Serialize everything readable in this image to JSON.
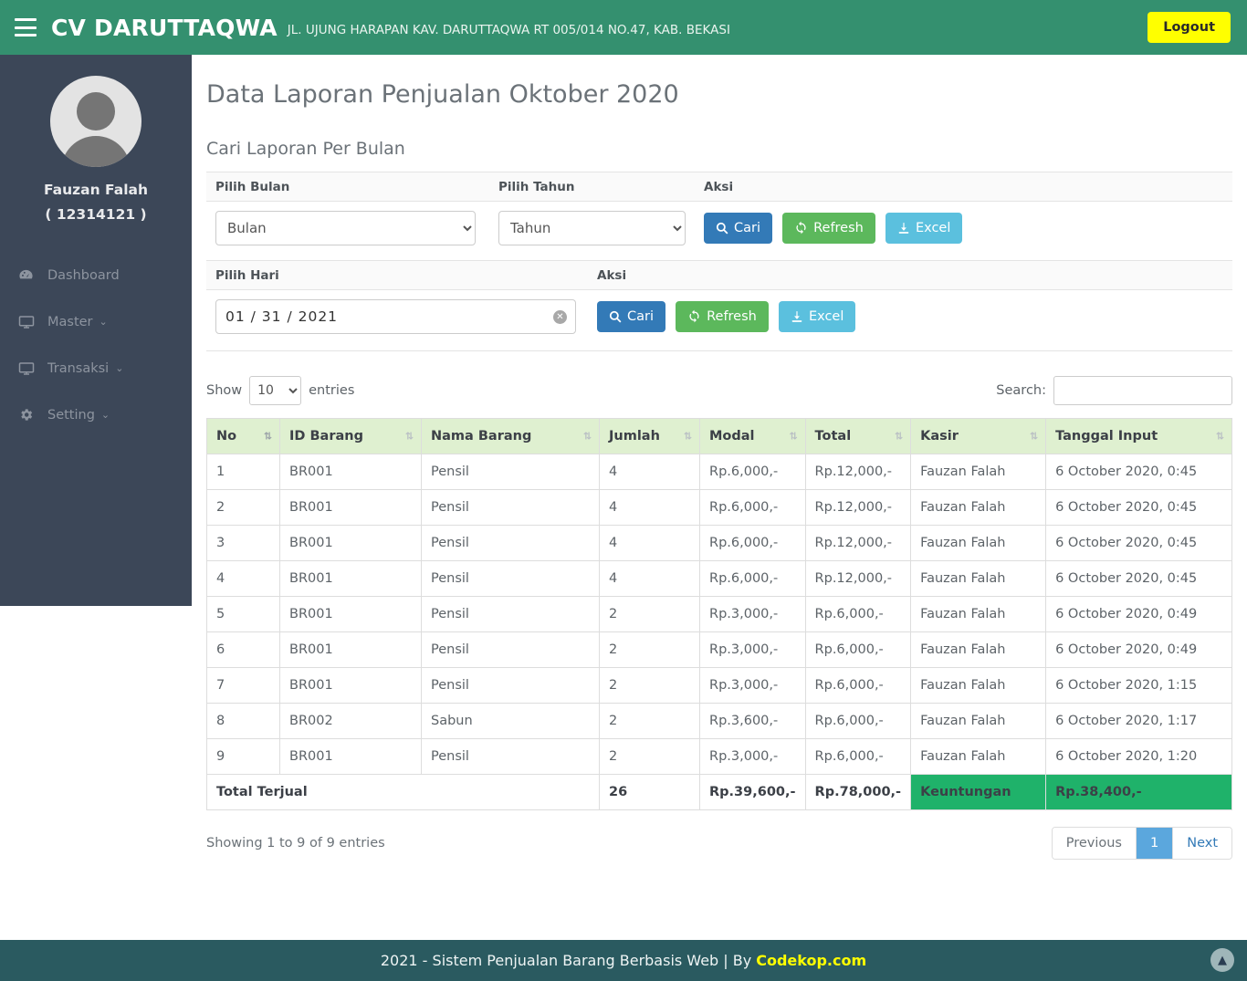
{
  "navbar": {
    "menu_icon": "hamburger-icon",
    "brand": "CV DARUTTAQWA",
    "address": "JL. UJUNG HARAPAN KAV. DARUTTAQWA RT 005/014 NO.47, KAB. BEKASI",
    "logout_label": "Logout",
    "bg_color": "#34906f",
    "logout_color": "#ffff00"
  },
  "sidebar": {
    "user_name": "Fauzan Falah",
    "user_id": "( 12314121 )",
    "bg_color": "#3c4758",
    "items": [
      {
        "label": "Dashboard",
        "icon": "dashboard-icon",
        "has_caret": false
      },
      {
        "label": "Master",
        "icon": "monitor-icon",
        "has_caret": true,
        "caret": "⌄"
      },
      {
        "label": "Transaksi",
        "icon": "monitor-icon",
        "has_caret": true,
        "caret": "⌄"
      },
      {
        "label": "Setting",
        "icon": "gear-icon",
        "has_caret": true,
        "caret": "⌄"
      }
    ]
  },
  "main": {
    "page_title": "Data Laporan Penjualan Oktober 2020",
    "section_subtitle": "Cari Laporan Per Bulan"
  },
  "filter_month": {
    "headers": {
      "month": "Pilih Bulan",
      "year": "Pilih Tahun",
      "action": "Aksi"
    },
    "month_value": "Bulan",
    "year_value": "Tahun",
    "buttons": {
      "search": "Cari",
      "refresh": "Refresh",
      "excel": "Excel"
    },
    "colors": {
      "search": "#337ab7",
      "refresh": "#5cb85c",
      "excel": "#5bc0de"
    }
  },
  "filter_day": {
    "headers": {
      "day": "Pilih Hari",
      "action": "Aksi"
    },
    "date_value": "01 / 31 / 2021",
    "buttons": {
      "search": "Cari",
      "refresh": "Refresh",
      "excel": "Excel"
    }
  },
  "datatable": {
    "show_label": "Show",
    "entries_label": "entries",
    "page_length": "10",
    "search_label": "Search:",
    "search_value": "",
    "search_placeholder": "",
    "columns": [
      "No",
      "ID Barang",
      "Nama Barang",
      "Jumlah",
      "Modal",
      "Total",
      "Kasir",
      "Tanggal Input"
    ],
    "rows": [
      [
        "1",
        "BR001",
        "Pensil",
        "4",
        "Rp.6,000,-",
        "Rp.12,000,-",
        "Fauzan Falah",
        "6 October 2020, 0:45"
      ],
      [
        "2",
        "BR001",
        "Pensil",
        "4",
        "Rp.6,000,-",
        "Rp.12,000,-",
        "Fauzan Falah",
        "6 October 2020, 0:45"
      ],
      [
        "3",
        "BR001",
        "Pensil",
        "4",
        "Rp.6,000,-",
        "Rp.12,000,-",
        "Fauzan Falah",
        "6 October 2020, 0:45"
      ],
      [
        "4",
        "BR001",
        "Pensil",
        "4",
        "Rp.6,000,-",
        "Rp.12,000,-",
        "Fauzan Falah",
        "6 October 2020, 0:45"
      ],
      [
        "5",
        "BR001",
        "Pensil",
        "2",
        "Rp.3,000,-",
        "Rp.6,000,-",
        "Fauzan Falah",
        "6 October 2020, 0:49"
      ],
      [
        "6",
        "BR001",
        "Pensil",
        "2",
        "Rp.3,000,-",
        "Rp.6,000,-",
        "Fauzan Falah",
        "6 October 2020, 0:49"
      ],
      [
        "7",
        "BR001",
        "Pensil",
        "2",
        "Rp.3,000,-",
        "Rp.6,000,-",
        "Fauzan Falah",
        "6 October 2020, 1:15"
      ],
      [
        "8",
        "BR002",
        "Sabun",
        "2",
        "Rp.3,600,-",
        "Rp.6,000,-",
        "Fauzan Falah",
        "6 October 2020, 1:17"
      ],
      [
        "9",
        "BR001",
        "Pensil",
        "2",
        "Rp.3,000,-",
        "Rp.6,000,-",
        "Fauzan Falah",
        "6 October 2020, 1:20"
      ]
    ],
    "total_row": {
      "label": "Total Terjual",
      "jumlah": "26",
      "modal": "Rp.39,600,-",
      "total": "Rp.78,000,-",
      "profit_label": "Keuntungan",
      "profit_value": "Rp.38,400,-",
      "profit_color": "#1fb26a"
    },
    "info": "Showing 1 to 9 of 9 entries",
    "pagination": {
      "previous": "Previous",
      "current": "1",
      "next": "Next"
    }
  },
  "footer": {
    "text": "2021 - Sistem Penjualan Barang Berbasis Web | By",
    "brand": "Codekop.com",
    "bg_color": "#2a5a60",
    "scroll_top_icon": "chevron-up-icon"
  }
}
